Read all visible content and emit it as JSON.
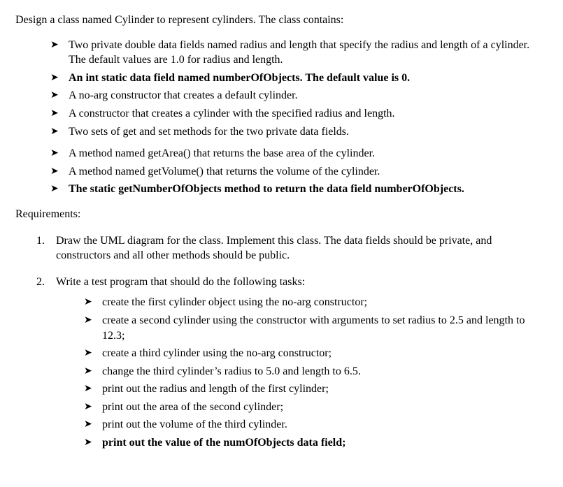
{
  "intro": "Design a class named Cylinder to represent cylinders.  The class contains:",
  "spec_items": [
    {
      "text": "Two private double data fields named radius and length that specify the radius and length of a cylinder. The default values are 1.0 for radius and length.",
      "bold": false
    },
    {
      "text": "An int static data field named numberOfObjects. The default value is 0.",
      "bold": true
    },
    {
      "text": "A no-arg constructor that creates a default cylinder.",
      "bold": false
    },
    {
      "text": "A constructor that creates a cylinder with the specified radius and length.",
      "bold": false
    },
    {
      "text": "Two sets of get and set methods for the two private data fields.",
      "bold": false
    },
    {
      "text": "A method named getArea() that returns the base area of the cylinder.",
      "bold": false
    },
    {
      "text": "A method named getVolume() that returns the volume of the cylinder.",
      "bold": false
    },
    {
      "text": "The static getNumberOfObjects method to return the data field numberOfObjects.",
      "bold": true
    }
  ],
  "requirements_label": "Requirements:",
  "req1": {
    "num": "1.",
    "text": "Draw the UML diagram for the class.  Implement this class. The data fields should be private, and constructors and all other methods should be public."
  },
  "req2": {
    "num": "2.",
    "text": "Write a test program that should do the following tasks:",
    "tasks": [
      {
        "text": "create the first cylinder object using the no-arg constructor;",
        "bold": false
      },
      {
        "text": "create a second cylinder using the constructor with arguments to set radius to 2.5 and length to 12.3;",
        "bold": false
      },
      {
        "text": "create a third cylinder using the no-arg constructor;",
        "bold": false
      },
      {
        "text": "change the third cylinder’s radius to 5.0 and length to 6.5.",
        "bold": false
      },
      {
        "text": "print out the radius and length of the first cylinder;",
        "bold": false
      },
      {
        "text": "print out the area of the second cylinder;",
        "bold": false
      },
      {
        "text": "print out the volume of the third cylinder.",
        "bold": false
      },
      {
        "text": "print out the value of the numOfObjects data field;",
        "bold": true
      }
    ]
  }
}
